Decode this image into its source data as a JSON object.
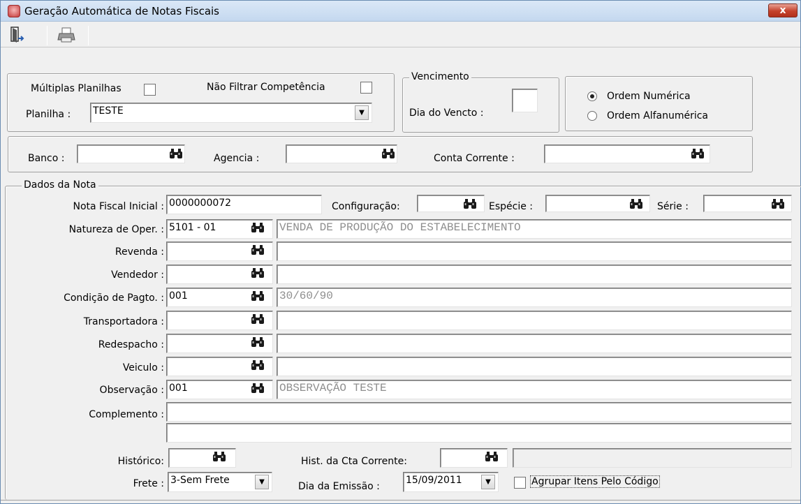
{
  "window": {
    "title": "Geração Automática de Notas Fiscais",
    "close_label": "x"
  },
  "toolbar": {
    "exit_icon": "exit-door-icon",
    "print_icon": "printer-icon"
  },
  "filters": {
    "multiplas_planilhas_label": "Múltiplas Planilhas",
    "multiplas_planilhas_checked": false,
    "nao_filtrar_label": "Não Filtrar Competência",
    "nao_filtrar_checked": false,
    "planilha_label": "Planilha :",
    "planilha_value": "TESTE"
  },
  "vencimento": {
    "legend": "Vencimento",
    "dia_label": "Dia do Vencto :",
    "dia_value": ""
  },
  "ordem": {
    "options": [
      "Ordem Numérica",
      "Ordem Alfanumérica"
    ],
    "selected": "Ordem Numérica"
  },
  "banco": {
    "banco_label": "Banco :",
    "banco_value": "",
    "agencia_label": "Agencia :",
    "agencia_value": "",
    "conta_label": "Conta Corrente :",
    "conta_value": ""
  },
  "dados": {
    "legend": "Dados da Nota",
    "nota_label": "Nota Fiscal Inicial :",
    "nota_value": "0000000072",
    "config_label": "Configuração:",
    "config_value": "",
    "especie_label": "Espécie :",
    "especie_value": "",
    "serie_label": "Série :",
    "serie_value": "",
    "natureza_label": "Natureza de  Oper. :",
    "natureza_code": "5101 - 01",
    "natureza_desc": "VENDA DE PRODUÇÃO DO ESTABELECIMENTO",
    "revenda_label": "Revenda :",
    "revenda_code": "",
    "revenda_desc": "",
    "vendedor_label": "Vendedor :",
    "vendedor_code": "",
    "vendedor_desc": "",
    "condicao_label": "Condição de Pagto. :",
    "condicao_code": "001",
    "condicao_desc": "30/60/90",
    "transp_label": "Transportadora :",
    "transp_code": "",
    "transp_desc": "",
    "redesp_label": "Redespacho :",
    "redesp_code": "",
    "redesp_desc": "",
    "veiculo_label": "Veiculo :",
    "veiculo_code": "",
    "veiculo_desc": "",
    "obs_label": "Observação :",
    "obs_code": "001",
    "obs_desc": "OBSERVAÇÃO TESTE",
    "compl_label": "Complemento :",
    "compl_line1": "",
    "compl_line2": "",
    "hist_label": "Histórico:",
    "hist_value": "",
    "hist_cta_label": "Hist. da Cta Corrente:",
    "hist_cta_value": "",
    "hist_cta_desc": "",
    "frete_label": "Frete :",
    "frete_value": "3-Sem Frete",
    "emissao_label": "Dia da Emissão :",
    "emissao_value": "15/09/2011",
    "agrupar_label": "Agrupar Itens Pelo Código",
    "agrupar_checked": false
  }
}
